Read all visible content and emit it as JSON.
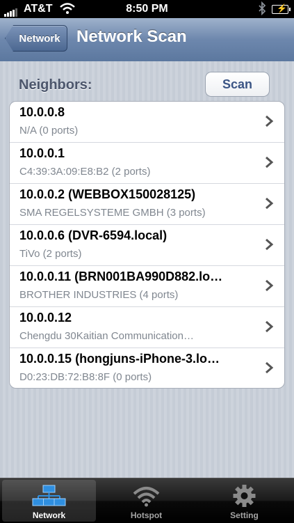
{
  "status_bar": {
    "carrier": "AT&T",
    "time": "8:50 PM"
  },
  "nav": {
    "back_label": "Network",
    "title": "Network Scan"
  },
  "section": {
    "header": "Neighbors:",
    "scan_label": "Scan"
  },
  "neighbors": [
    {
      "title": "10.0.0.8",
      "subtitle": "N/A (0 ports)"
    },
    {
      "title": "10.0.0.1",
      "subtitle": "C4:39:3A:09:E8:B2 (2 ports)"
    },
    {
      "title": "10.0.0.2 (WEBBOX150028125)",
      "subtitle": "SMA REGELSYSTEME GMBH (3 ports)"
    },
    {
      "title": "10.0.0.6 (DVR-6594.local)",
      "subtitle": "TiVo (2 ports)"
    },
    {
      "title": "10.0.0.11 (BRN001BA990D882.lo…",
      "subtitle": "BROTHER INDUSTRIES (4 ports)"
    },
    {
      "title": "10.0.0.12",
      "subtitle": "Chengdu 30Kaitian Communication…"
    },
    {
      "title": "10.0.0.15 (hongjuns-iPhone-3.lo…",
      "subtitle": "D0:23:DB:72:B8:8F (0 ports)"
    }
  ],
  "tabs": [
    {
      "label": "Network",
      "icon": "network-icon",
      "active": true
    },
    {
      "label": "Hotspot",
      "icon": "wifi-icon",
      "active": false
    },
    {
      "label": "Setting",
      "icon": "gear-icon",
      "active": false
    }
  ],
  "colors": {
    "nav_bar": "#6d87ad",
    "accent": "#3b5585",
    "tab_active_icon": "#2f8fe0"
  }
}
